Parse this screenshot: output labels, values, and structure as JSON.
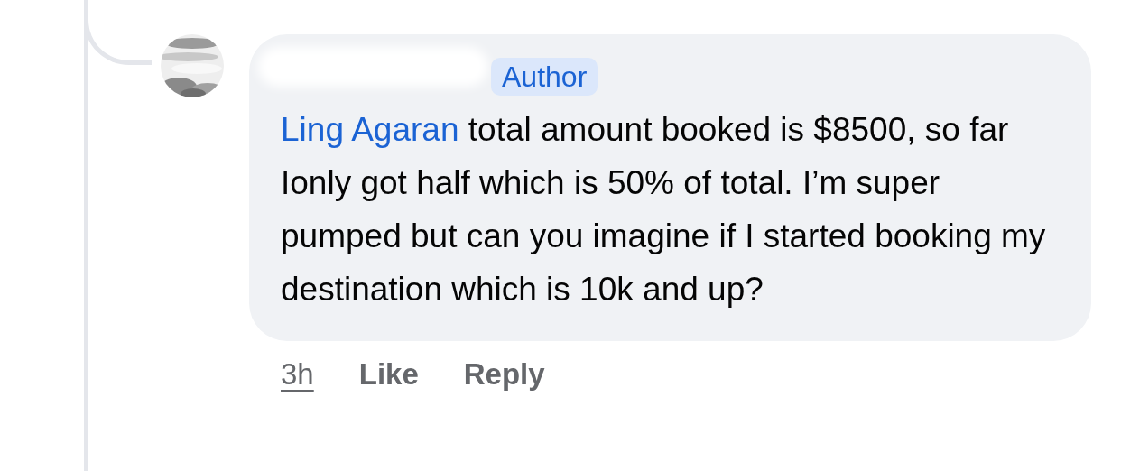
{
  "comment": {
    "author_badge": "Author",
    "mention": "Ling Agaran",
    "text": "total amount booked is $8500, so far Ionly got half which is 50% of total. I’m super pumped but can you imagine if I started booking my destination which is 10k and up?"
  },
  "actions": [
    {
      "kind": "time",
      "label": "3h"
    },
    {
      "kind": "button",
      "label": "Like"
    },
    {
      "kind": "button",
      "label": "Reply"
    }
  ]
}
